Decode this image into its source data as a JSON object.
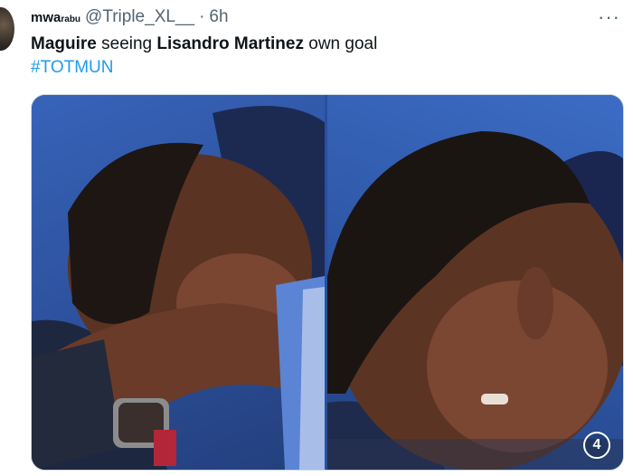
{
  "user": {
    "display_name": "mwa",
    "display_name_suffix": "rabu",
    "handle": "@Triple_XL__",
    "separator": "·",
    "time": "6h"
  },
  "more_glyph": "···",
  "tweet": {
    "w1": "Maguire",
    "w2": " seeing ",
    "w3": "Lisandro Martinez",
    "w4": " own goal",
    "hashtag": "#TOTMUN"
  },
  "media": {
    "badge": "4"
  }
}
